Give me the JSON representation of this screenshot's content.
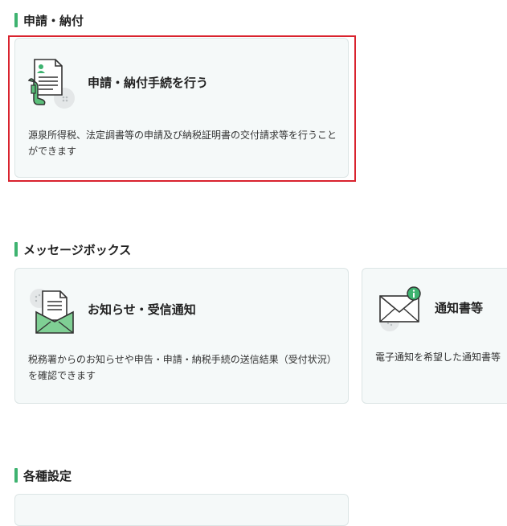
{
  "sections": {
    "apply": {
      "heading": "申請・納付",
      "card": {
        "title": "申請・納付手続を行う",
        "description": "源泉所得税、法定調書等の申請及び納税証明書の交付請求等を行うことができます",
        "icon": "document-hand-icon"
      }
    },
    "messagebox": {
      "heading": "メッセージボックス",
      "cards": [
        {
          "title": "お知らせ・受信通知",
          "description": "税務署からのお知らせや申告・申請・納税手続の送信結果（受付状況）を確認できます",
          "icon": "envelope-letter-icon"
        },
        {
          "title": "通知書等",
          "description": "電子通知を希望した通知書等",
          "icon": "envelope-info-icon"
        }
      ]
    },
    "settings": {
      "heading": "各種設定"
    }
  },
  "colors": {
    "accent_green": "#3eb370",
    "highlight_red": "#d9232e",
    "card_bg": "#f5f9f9"
  }
}
